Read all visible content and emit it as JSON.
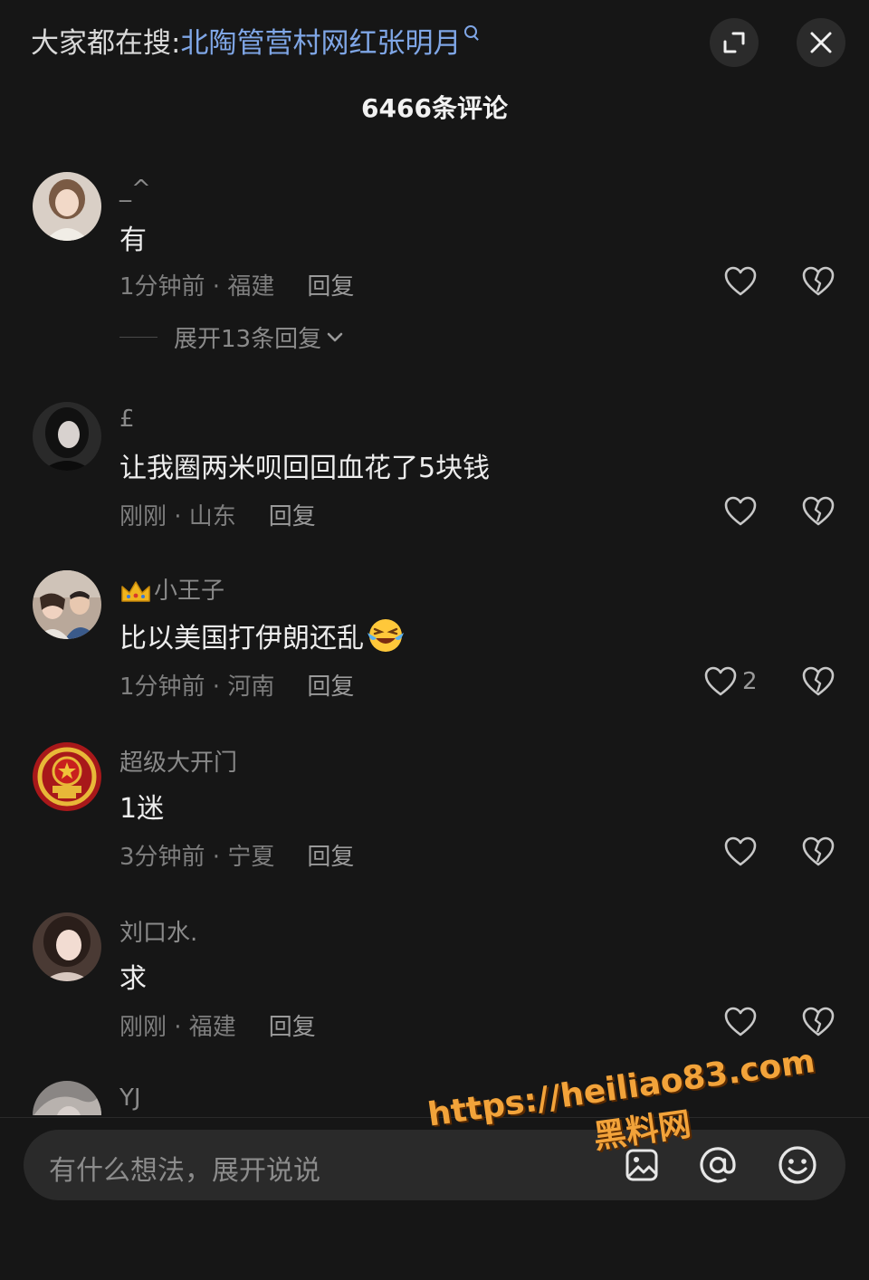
{
  "header": {
    "hot_search_prefix": "大家都在搜:",
    "hot_search_term": "北陶管营村网红张明月",
    "comment_count": "6466条评论",
    "expand_icon": "expand-icon",
    "close_icon": "close-icon"
  },
  "comments": [
    {
      "username": "_^",
      "text": "有",
      "time_location": "1分钟前 · 福建",
      "reply_label": "回复",
      "like_count": "",
      "expand_label": "展开13条回复"
    },
    {
      "username": "£",
      "text": "让我圈两米呗回回血花了5块钱",
      "time_location": "刚刚 · 山东",
      "reply_label": "回复",
      "like_count": ""
    },
    {
      "username": "小王子",
      "text": "比以美国打伊朗还乱",
      "time_location": "1分钟前 · 河南",
      "reply_label": "回复",
      "like_count": "2"
    },
    {
      "username": "超级大开门",
      "text": "1迷",
      "time_location": "3分钟前 · 宁夏",
      "reply_label": "回复",
      "like_count": ""
    },
    {
      "username": "刘口水.",
      "text": "求",
      "time_location": "刚刚 · 福建",
      "reply_label": "回复",
      "like_count": ""
    },
    {
      "username": "YJ"
    }
  ],
  "input_bar": {
    "placeholder": "有什么想法，展开说说",
    "icons": [
      "image-icon",
      "at-icon",
      "emoji-icon"
    ]
  },
  "watermark": {
    "url": "https://heiliao83.com",
    "name": "黑料网"
  },
  "colors": {
    "background": "#161616",
    "link_blue": "#7fa6e6",
    "watermark_orange": "#f2a33a"
  }
}
